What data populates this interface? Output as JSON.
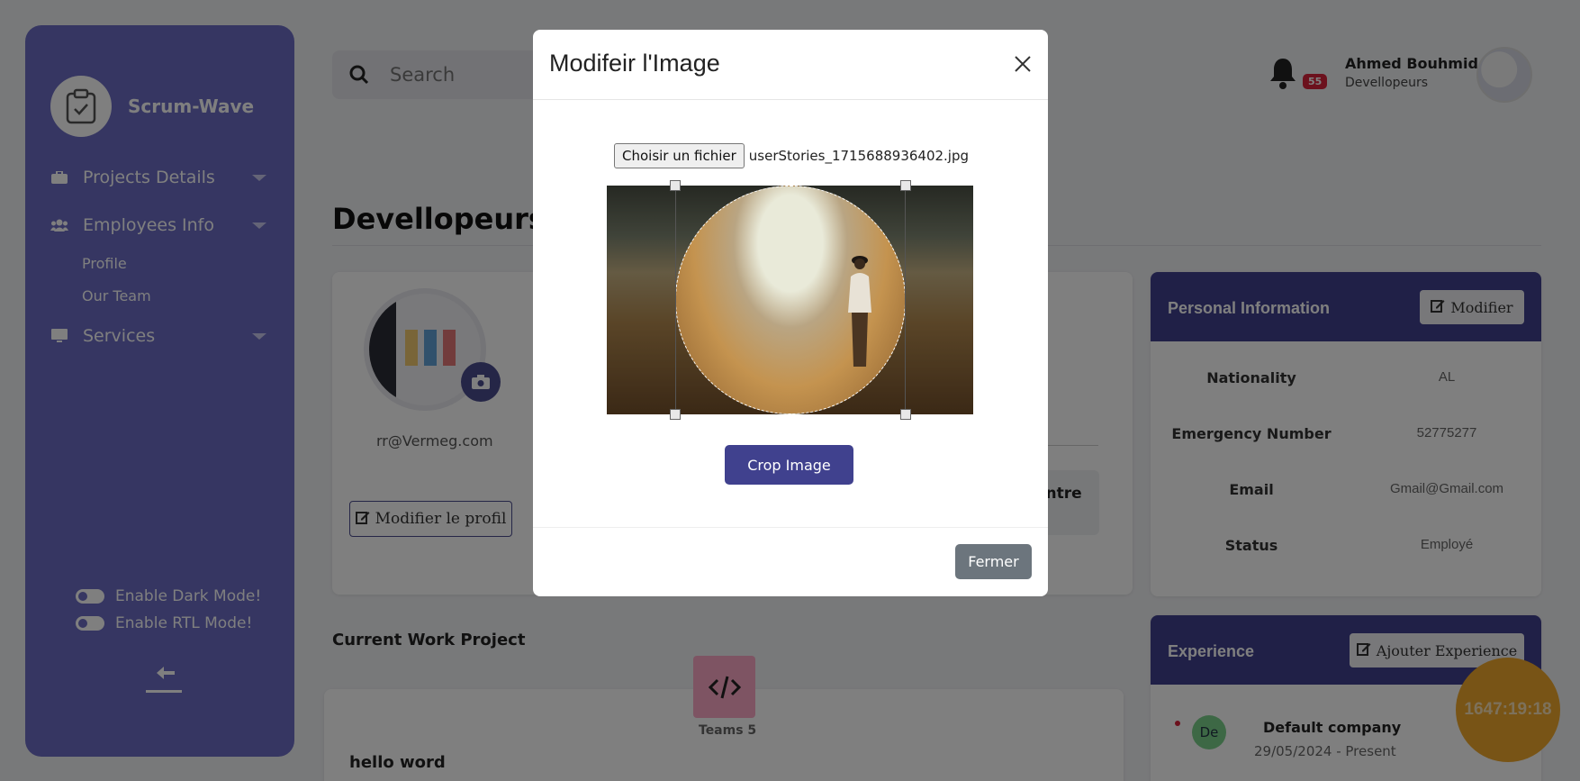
{
  "brand": {
    "name": "Scrum-Wave"
  },
  "sidebar": {
    "items": [
      {
        "label": "Projects Details"
      },
      {
        "label": "Employees Info"
      },
      {
        "label": "Services"
      }
    ],
    "subitems": [
      {
        "label": "Profile"
      },
      {
        "label": "Our Team"
      }
    ],
    "toggles": [
      {
        "label": "Enable Dark Mode!"
      },
      {
        "label": "Enable RTL Mode!"
      }
    ]
  },
  "search": {
    "placeholder": "Search"
  },
  "notifications": {
    "count": "55"
  },
  "user": {
    "name": "Ahmed Bouhmid",
    "role": "Devellopeurs"
  },
  "page": {
    "title": "Devellopeurs I"
  },
  "profile": {
    "email": "rr@Vermeg.com",
    "edit_label": "Modifier le profil",
    "partial_label": "entre"
  },
  "personal_info": {
    "title": "Personal Information",
    "button": "Modifier",
    "rows": [
      {
        "label": "Nationality",
        "value": "AL"
      },
      {
        "label": "Emergency Number",
        "value": "52775277"
      },
      {
        "label": "Email",
        "value": "Gmail@Gmail.com"
      },
      {
        "label": "Status",
        "value": "Employé"
      }
    ]
  },
  "experience": {
    "title": "Experience",
    "button": "Ajouter Experience",
    "items": [
      {
        "initials": "De",
        "company": "Default company",
        "date": "29/05/2024 - Present"
      }
    ]
  },
  "current_work": {
    "title": "Current Work Project",
    "teams_label": "Teams 5",
    "project_name": "hello word"
  },
  "timer": {
    "value": "1647:19:18"
  },
  "modal": {
    "title": "Modifeir l'Image",
    "file_button": "Choisir un fichier",
    "file_name": "userStories_1715688936402.jpg",
    "crop_button": "Crop Image",
    "close_button": "Fermer"
  },
  "colors": {
    "sidebar": "#6c6dc4",
    "header": "#40418e",
    "badge": "#d9233a",
    "timer": "#f0a92c"
  }
}
